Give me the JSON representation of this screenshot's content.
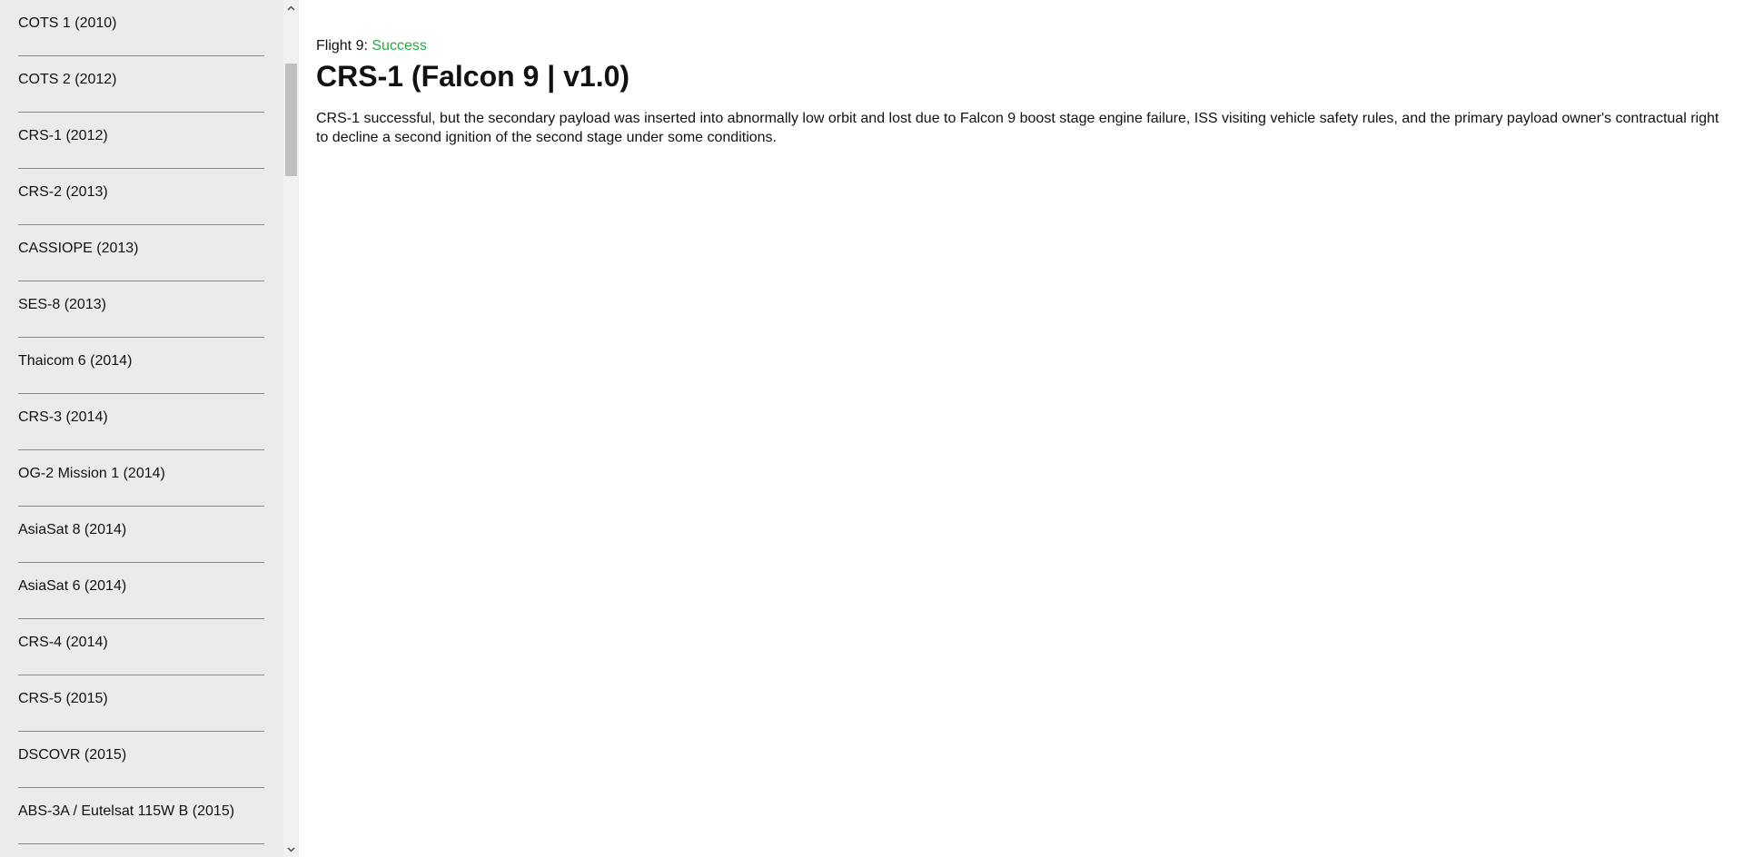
{
  "sidebar": {
    "items": [
      {
        "label": "COTS 1 (2010)"
      },
      {
        "label": "COTS 2 (2012)"
      },
      {
        "label": "CRS-1 (2012)"
      },
      {
        "label": "CRS-2 (2013)"
      },
      {
        "label": "CASSIOPE (2013)"
      },
      {
        "label": "SES-8 (2013)"
      },
      {
        "label": "Thaicom 6 (2014)"
      },
      {
        "label": "CRS-3 (2014)"
      },
      {
        "label": "OG-2 Mission 1 (2014)"
      },
      {
        "label": "AsiaSat 8 (2014)"
      },
      {
        "label": "AsiaSat 6 (2014)"
      },
      {
        "label": "CRS-4 (2014)"
      },
      {
        "label": "CRS-5 (2015)"
      },
      {
        "label": "DSCOVR (2015)"
      },
      {
        "label": "ABS-3A / Eutelsat 115W B (2015)"
      }
    ]
  },
  "main": {
    "flight_prefix": "Flight 9:",
    "status": "Success",
    "status_color": "#28a745",
    "title": "CRS-1 (Falcon 9 | v1.0)",
    "details": "CRS-1 successful, but the secondary payload was inserted into abnormally low orbit and lost due to Falcon 9 boost stage engine failure, ISS visiting vehicle safety rules, and the primary payload owner's contractual right to decline a second ignition of the second stage under some conditions."
  },
  "icons": {
    "scroll_up": "chevron-up-icon",
    "scroll_down": "chevron-down-icon"
  }
}
